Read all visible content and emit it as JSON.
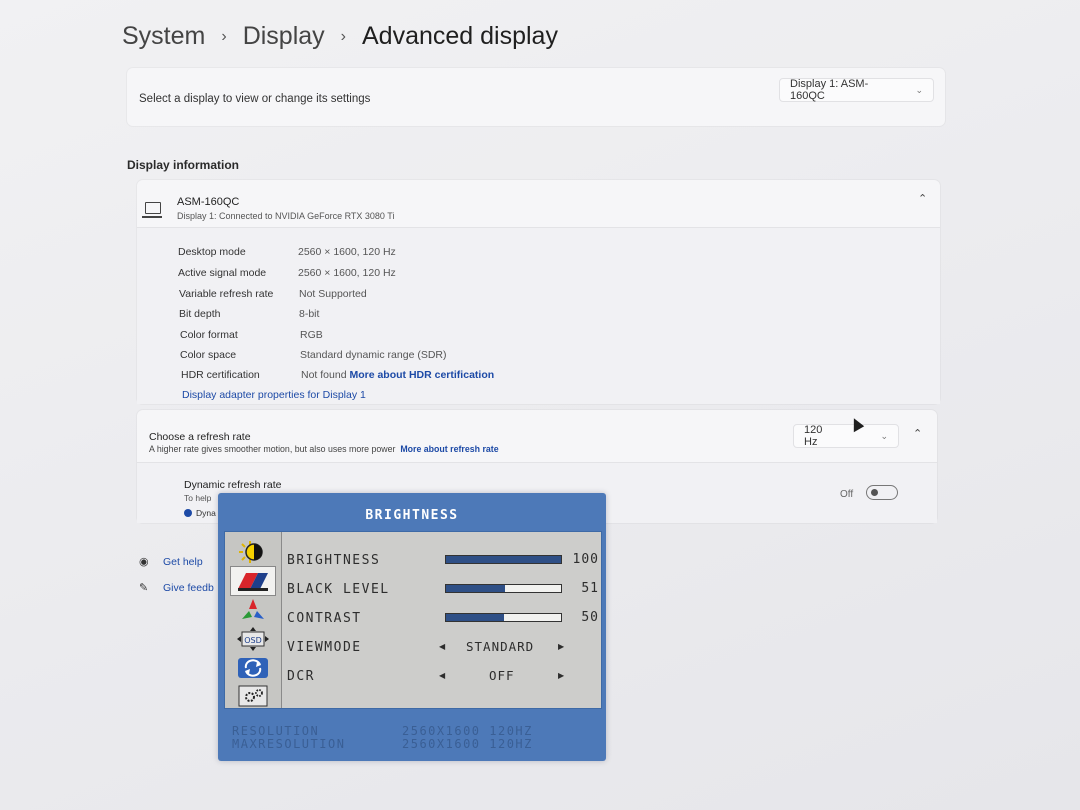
{
  "breadcrumb": {
    "root": "System",
    "middle": "Display",
    "current": "Advanced display"
  },
  "display_select": {
    "label": "Select a display to view or change its settings",
    "selected": "Display 1: ASM-160QC"
  },
  "display_info": {
    "section_title": "Display information",
    "monitor_name": "ASM-160QC",
    "connection": "Display 1: Connected to NVIDIA GeForce RTX 3080 Ti",
    "rows": [
      {
        "key": "Desktop mode",
        "value": "2560 × 1600, 120 Hz"
      },
      {
        "key": "Active signal mode",
        "value": "2560 × 1600, 120 Hz"
      },
      {
        "key": "Variable refresh rate",
        "value": "Not Supported"
      },
      {
        "key": "Bit depth",
        "value": "8-bit"
      },
      {
        "key": "Color format",
        "value": "RGB"
      },
      {
        "key": "Color space",
        "value": "Standard dynamic range (SDR)"
      },
      {
        "key": "HDR certification",
        "value": "Not found"
      }
    ],
    "hdr_link": "More about HDR certification",
    "adapter_link": "Display adapter properties for Display 1"
  },
  "refresh": {
    "title": "Choose a refresh rate",
    "subtitle": "A higher rate gives smoother motion, but also uses more power",
    "link": "More about refresh rate",
    "selected": "120 Hz",
    "dynamic_title": "Dynamic refresh rate",
    "dynamic_sub": "To help",
    "dynamic_note": "Dyna",
    "toggle_label": "Off",
    "toggle_state": "off"
  },
  "help": {
    "get_help": "Get help",
    "feedback": "Give feedb"
  },
  "osd": {
    "title": "BRIGHTNESS",
    "items": [
      {
        "label": "BRIGHTNESS",
        "value": "100",
        "level": 100
      },
      {
        "label": "BLACK LEVEL",
        "value": "51",
        "level": 51
      },
      {
        "label": "CONTRAST",
        "value": "50",
        "level": 50
      }
    ],
    "viewmode": {
      "label": "VIEWMODE",
      "value": "STANDARD"
    },
    "dcr": {
      "label": "DCR",
      "value": "OFF"
    },
    "icon_label_osd": "OSD",
    "footer": [
      {
        "key": "RESOLUTION",
        "value": "2560X1600 120HZ"
      },
      {
        "key": "MAXRESOLUTION",
        "value": "2560X1600 120HZ"
      }
    ]
  }
}
